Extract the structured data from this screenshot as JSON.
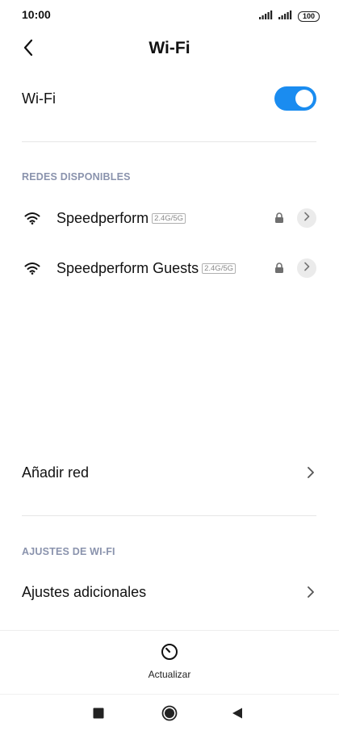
{
  "status_bar": {
    "time": "10:00",
    "battery": "100",
    "icons": [
      "signal-icon",
      "signal-icon",
      "battery-icon"
    ]
  },
  "header": {
    "title": "Wi-Fi",
    "back_icon": "chevron-left-icon"
  },
  "wifi_toggle": {
    "label": "Wi-Fi",
    "enabled": true,
    "color": "#1a8cf0"
  },
  "available_networks": {
    "header": "REDES DISPONIBLES",
    "items": [
      {
        "name": "Speedperform",
        "band": "2.4G/5G",
        "secured": true
      },
      {
        "name": "Speedperform Guests",
        "band": "2.4G/5G",
        "secured": true
      }
    ]
  },
  "add_network": {
    "label": "Añadir red"
  },
  "wifi_settings": {
    "header": "AJUSTES DE WI-FI",
    "items": [
      {
        "label": "Ajustes adicionales"
      }
    ]
  },
  "bottom_action": {
    "label": "Actualizar",
    "icon": "refresh-icon"
  },
  "nav_bar": {
    "icons": [
      "recents-icon",
      "home-icon",
      "back-icon"
    ]
  },
  "colors": {
    "accent": "#1a8cf0",
    "section_header": "#8a93ad"
  }
}
